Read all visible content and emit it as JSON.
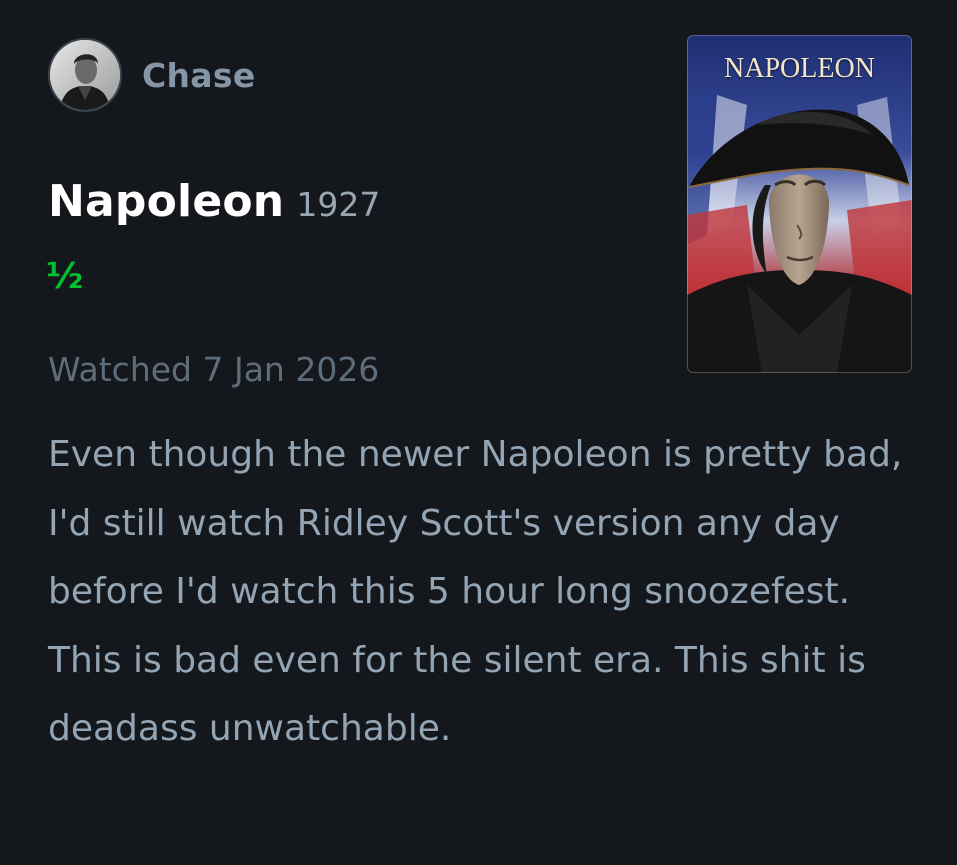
{
  "author": {
    "name": "Chase",
    "avatar_icon": "person-avatar-icon"
  },
  "film": {
    "title": "Napoleon",
    "year": "1927",
    "poster_title": "NAPOLEON"
  },
  "rating": {
    "display": "½",
    "value": 0.5,
    "max": 5,
    "color": "#00c030"
  },
  "watched_label": "Watched 7 Jan 2026",
  "review_text": "Even though the newer Napoleon is pretty bad, I'd still watch Ridley Scott's version any day before I'd watch this 5 hour long snoozefest. This is bad even for the silent era. This shit is deadass unwatchable.",
  "colors": {
    "background": "#14181c",
    "title": "#ffffff",
    "muted": "#5e6d7b",
    "body_text": "#93a4b4",
    "accent_green": "#00c030"
  }
}
